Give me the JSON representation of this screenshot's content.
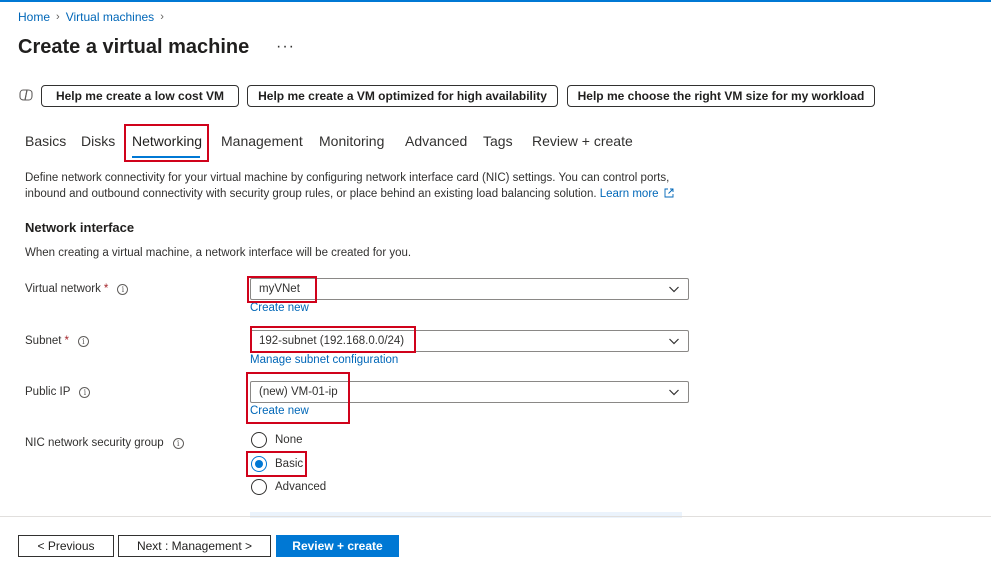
{
  "breadcrumb": {
    "home": "Home",
    "vms": "Virtual machines"
  },
  "page": {
    "title": "Create a virtual machine",
    "more": "···"
  },
  "copilot": {
    "low_cost": "Help me create a low cost VM",
    "high_avail": "Help me create a VM optimized for high availability",
    "vm_size": "Help me choose the right VM size for my workload"
  },
  "tabs": [
    "Basics",
    "Disks",
    "Networking",
    "Management",
    "Monitoring",
    "Advanced",
    "Tags",
    "Review + create"
  ],
  "active_tab": "Networking",
  "description": {
    "text": "Define network connectivity for your virtual machine by configuring network interface card (NIC) settings. You can control ports, inbound and outbound connectivity with security group rules, or place behind an existing load balancing solution.",
    "learn_more": "Learn more"
  },
  "network_interface": {
    "title": "Network interface",
    "note": "When creating a virtual machine, a network interface will be created for you.",
    "virtual_network": {
      "label": "Virtual network",
      "required": "*",
      "value": "myVNet",
      "link": "Create new"
    },
    "subnet": {
      "label": "Subnet",
      "required": "*",
      "value": "192-subnet (192.168.0.0/24)",
      "link": "Manage subnet configuration"
    },
    "public_ip": {
      "label": "Public IP",
      "value": "(new) VM-01-ip",
      "link": "Create new"
    },
    "nsg": {
      "label": "NIC network security group",
      "options": [
        "None",
        "Basic",
        "Advanced"
      ],
      "selected": "Basic"
    }
  },
  "footer": {
    "previous": "< Previous",
    "next": "Next : Management >",
    "review": "Review + create"
  },
  "colors": {
    "accent": "#0078d4",
    "link": "#0067b8",
    "highlight": "#d0021b"
  },
  "icons": {
    "copilot": "copilot-icon",
    "info": "info-icon",
    "chevron": "chevron-down-icon",
    "external": "external-link-icon",
    "breadcrumb_sep": "chevron-right-icon"
  }
}
